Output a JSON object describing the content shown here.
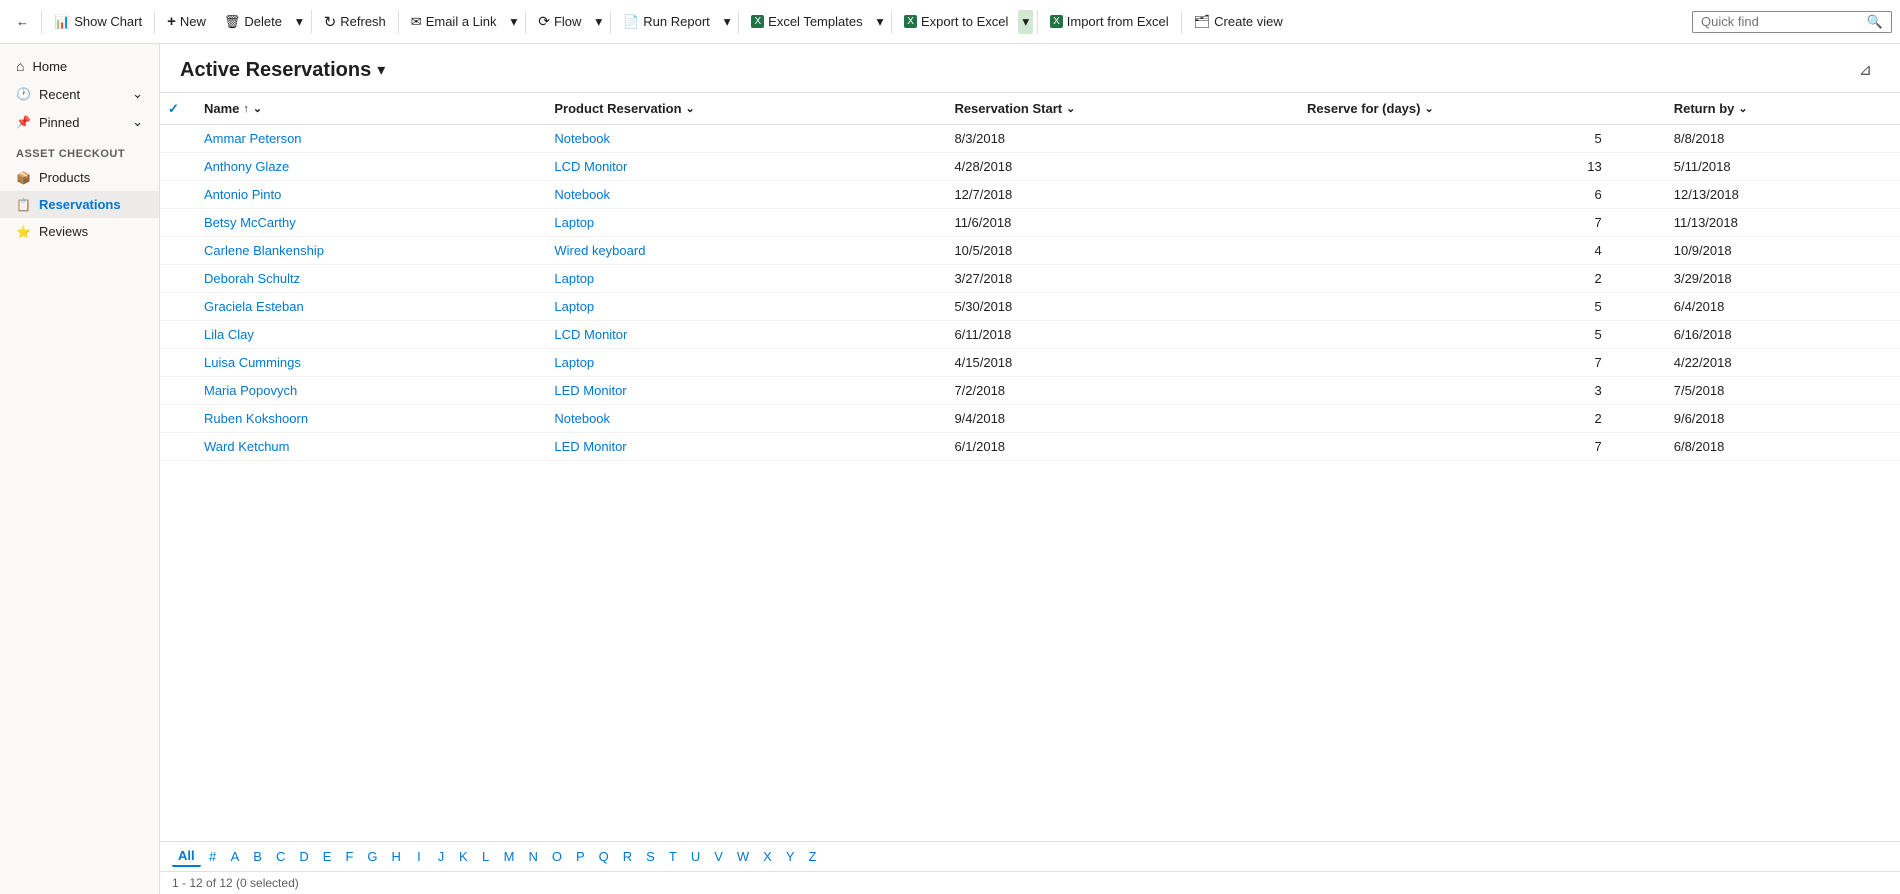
{
  "toolbar": {
    "back_label": "←",
    "show_chart_label": "Show Chart",
    "new_label": "New",
    "delete_label": "Delete",
    "refresh_label": "Refresh",
    "email_link_label": "Email a Link",
    "flow_label": "Flow",
    "run_report_label": "Run Report",
    "excel_templates_label": "Excel Templates",
    "export_to_excel_label": "Export to Excel",
    "import_from_excel_label": "Import from Excel",
    "create_view_label": "Create view"
  },
  "quick_find": {
    "placeholder": "Quick find",
    "value": ""
  },
  "sidebar": {
    "section_label": "Asset Checkout",
    "items": [
      {
        "label": "Home",
        "icon": "home-icon",
        "active": false
      },
      {
        "label": "Recent",
        "icon": "recent-icon",
        "has_chevron": true,
        "active": false
      },
      {
        "label": "Pinned",
        "icon": "pin-icon",
        "has_chevron": true,
        "active": false
      },
      {
        "label": "Products",
        "icon": "products-icon",
        "active": false
      },
      {
        "label": "Reservations",
        "icon": "reservations-icon",
        "active": true
      },
      {
        "label": "Reviews",
        "icon": "reviews-icon",
        "active": false
      }
    ]
  },
  "content": {
    "title": "Active Reservations",
    "title_chevron": "▾",
    "columns": [
      {
        "key": "name",
        "label": "Name",
        "sortable": true,
        "sorted": "asc"
      },
      {
        "key": "product",
        "label": "Product Reservation",
        "sortable": true
      },
      {
        "key": "start",
        "label": "Reservation Start",
        "sortable": true
      },
      {
        "key": "days",
        "label": "Reserve for (days)",
        "sortable": true
      },
      {
        "key": "return",
        "label": "Return by",
        "sortable": true
      }
    ],
    "rows": [
      {
        "name": "Ammar Peterson",
        "product": "Notebook",
        "start": "8/3/2018",
        "days": "5",
        "return": "8/8/2018"
      },
      {
        "name": "Anthony Glaze",
        "product": "LCD Monitor",
        "start": "4/28/2018",
        "days": "13",
        "return": "5/11/2018"
      },
      {
        "name": "Antonio Pinto",
        "product": "Notebook",
        "start": "12/7/2018",
        "days": "6",
        "return": "12/13/2018"
      },
      {
        "name": "Betsy McCarthy",
        "product": "Laptop",
        "start": "11/6/2018",
        "days": "7",
        "return": "11/13/2018"
      },
      {
        "name": "Carlene Blankenship",
        "product": "Wired keyboard",
        "start": "10/5/2018",
        "days": "4",
        "return": "10/9/2018"
      },
      {
        "name": "Deborah Schultz",
        "product": "Laptop",
        "start": "3/27/2018",
        "days": "2",
        "return": "3/29/2018"
      },
      {
        "name": "Graciela Esteban",
        "product": "Laptop",
        "start": "5/30/2018",
        "days": "5",
        "return": "6/4/2018"
      },
      {
        "name": "Lila Clay",
        "product": "LCD Monitor",
        "start": "6/11/2018",
        "days": "5",
        "return": "6/16/2018"
      },
      {
        "name": "Luisa Cummings",
        "product": "Laptop",
        "start": "4/15/2018",
        "days": "7",
        "return": "4/22/2018"
      },
      {
        "name": "Maria Popovych",
        "product": "LED Monitor",
        "start": "7/2/2018",
        "days": "3",
        "return": "7/5/2018"
      },
      {
        "name": "Ruben Kokshoorn",
        "product": "Notebook",
        "start": "9/4/2018",
        "days": "2",
        "return": "9/6/2018"
      },
      {
        "name": "Ward Ketchum",
        "product": "LED Monitor",
        "start": "6/1/2018",
        "days": "7",
        "return": "6/8/2018"
      }
    ]
  },
  "alphabet_bar": {
    "active": "All",
    "letters": [
      "All",
      "#",
      "A",
      "B",
      "C",
      "D",
      "E",
      "F",
      "G",
      "H",
      "I",
      "J",
      "K",
      "L",
      "M",
      "N",
      "O",
      "P",
      "Q",
      "R",
      "S",
      "T",
      "U",
      "V",
      "W",
      "X",
      "Y",
      "Z"
    ]
  },
  "footer": {
    "text": "1 - 12 of 12 (0 selected)"
  }
}
